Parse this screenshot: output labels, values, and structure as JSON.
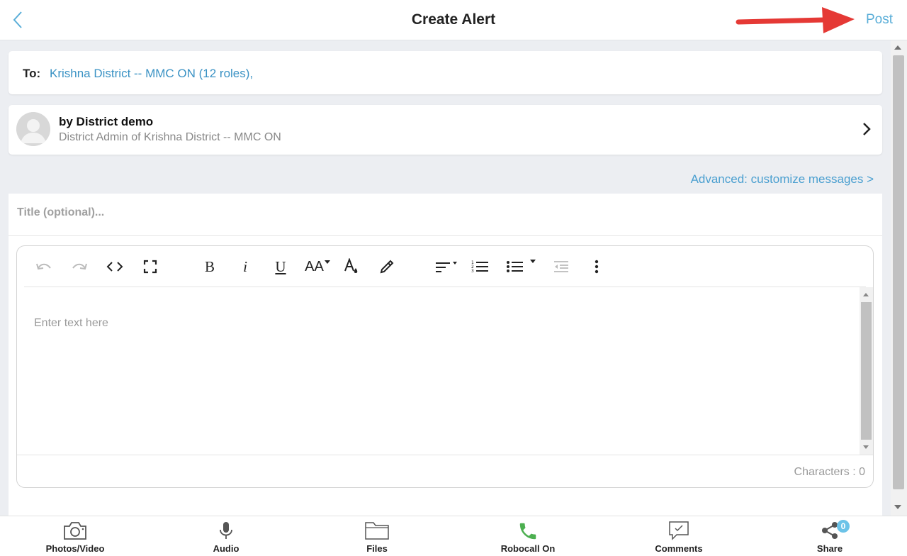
{
  "header": {
    "title": "Create Alert",
    "post_label": "Post"
  },
  "recipients": {
    "label": "To:",
    "value": "Krishna District -- MMC ON (12 roles),"
  },
  "author": {
    "name": "by District demo",
    "role": "District Admin of Krishna District -- MMC ON"
  },
  "advanced_link": "Advanced: customize messages >",
  "compose": {
    "title_placeholder": "Title (optional)...",
    "text_placeholder": "Enter text here",
    "character_count": "Characters : 0"
  },
  "toolbar": {
    "icons": [
      "undo-icon",
      "redo-icon",
      "code-view-icon",
      "fullscreen-icon",
      "bold-icon",
      "italic-icon",
      "underline-icon",
      "font-size-icon",
      "text-color-icon",
      "highlight-icon",
      "align-icon",
      "ordered-list-icon",
      "unordered-list-icon",
      "outdent-icon",
      "more-icon"
    ],
    "bold": "B",
    "italic": "i",
    "underline": "U",
    "font_size": "AA"
  },
  "bottom_bar": {
    "items": [
      {
        "label": "Photos/Video",
        "icon": "camera-icon"
      },
      {
        "label": "Audio",
        "icon": "microphone-icon"
      },
      {
        "label": "Files",
        "icon": "folder-icon"
      },
      {
        "label": "Robocall On",
        "icon": "phone-icon"
      },
      {
        "label": "Comments",
        "icon": "comment-icon"
      },
      {
        "label": "Share",
        "icon": "share-icon",
        "badge": "0"
      }
    ]
  },
  "colors": {
    "accent": "#3a92c4",
    "post": "#5aaed8",
    "robocall": "#4caf50",
    "badge": "#6cc3e8",
    "arrow": "#e53935"
  }
}
